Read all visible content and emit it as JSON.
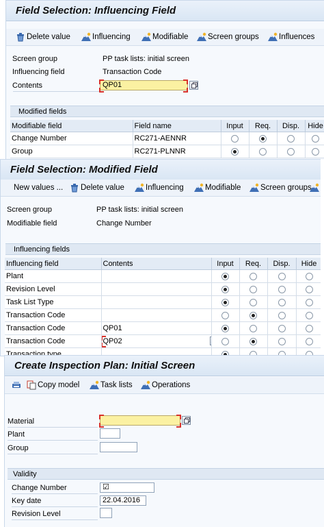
{
  "panel1": {
    "title": "Field Selection: Influencing Field",
    "toolbar": {
      "delete_value": "Delete value",
      "influencing": "Influencing",
      "modifiable": "Modifiable",
      "screen_groups": "Screen groups",
      "influences": "Influences"
    },
    "screen_group_label": "Screen group",
    "screen_group_value": "PP task lists: initial screen",
    "influencing_field_label": "Influencing field",
    "influencing_field_value": "Transaction Code",
    "contents_label": "Contents",
    "contents_value": "QP01",
    "section_title": "Modified fields",
    "columns": [
      "Modifiable field",
      "Field name",
      "Input",
      "Req.",
      "Disp.",
      "Hide"
    ],
    "rows": [
      {
        "field": "Change Number",
        "name": "RC271-AENNR",
        "selected": "req"
      },
      {
        "field": "Group",
        "name": "RC271-PLNNR",
        "selected": "input"
      }
    ]
  },
  "panel2": {
    "title": "Field Selection: Modified Field",
    "toolbar": {
      "new_values": "New values ...",
      "delete_value": "Delete value",
      "influencing": "Influencing",
      "modifiable": "Modifiable",
      "screen_groups": "Screen groups"
    },
    "screen_group_label": "Screen group",
    "screen_group_value": "PP task lists: initial screen",
    "modifiable_field_label": "Modifiable field",
    "modifiable_field_value": "Change Number",
    "section_title": "Influencing fields",
    "columns": [
      "Influencing field",
      "Contents",
      "Input",
      "Req.",
      "Disp.",
      "Hide"
    ],
    "rows": [
      {
        "field": "Plant",
        "contents": "",
        "selected": "input"
      },
      {
        "field": "Revision Level",
        "contents": "",
        "selected": "input"
      },
      {
        "field": "Task List Type",
        "contents": "",
        "selected": "input"
      },
      {
        "field": "Transaction Code",
        "contents": "",
        "selected": "req"
      },
      {
        "field": "Transaction Code",
        "contents": "QP01",
        "selected": "input"
      },
      {
        "field": "Transaction Code",
        "contents": "QP02",
        "selected": "req"
      },
      {
        "field": "Transaction type",
        "contents": "",
        "selected": "input"
      }
    ]
  },
  "panel3": {
    "title": "Create Inspection Plan: Initial Screen",
    "toolbar": {
      "copy_model": "Copy model",
      "task_lists": "Task lists",
      "operations": "Operations"
    },
    "material_label": "Material",
    "plant_label": "Plant",
    "group_label": "Group",
    "validity_title": "Validity",
    "change_number_label": "Change Number",
    "change_number_value": "☑",
    "key_date_label": "Key date",
    "key_date_value": "22.04.2016",
    "revision_level_label": "Revision Level"
  },
  "icons": {
    "delete": "trash-icon",
    "influencing": "mountain-icon",
    "modifiable": "mountain-icon",
    "screen_groups": "mountain-icon",
    "influences": "mountain-icon",
    "copy_model": "copy-icon",
    "task_lists": "mountain-icon",
    "operations": "mountain-icon",
    "value_help": "f4-help-icon"
  },
  "colors": {
    "required_field": "#fbf1a2",
    "required_marker": "#d8312a",
    "title_bar": "#d9e6f4"
  }
}
